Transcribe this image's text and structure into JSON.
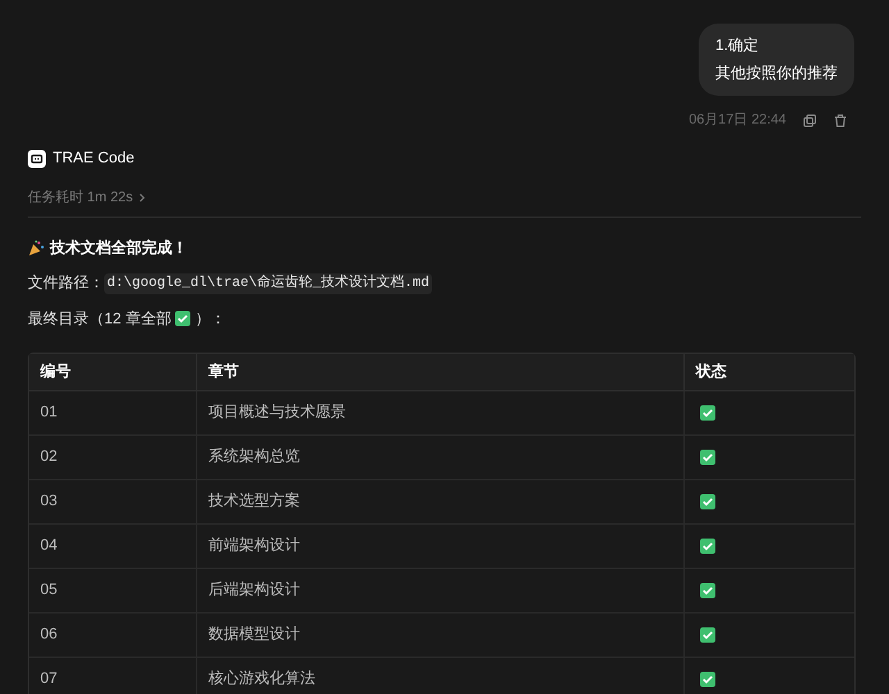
{
  "user_message": {
    "lines": [
      "1.确定",
      "其他按照你的推荐"
    ],
    "timestamp": "06月17日 22:44"
  },
  "assistant": {
    "name": "TRAE Code",
    "duration": "任务耗时 1m 22s",
    "title": "技术文档全部完成！",
    "path_label": "文件路径：",
    "path": "d:\\google_dl\\trae\\命运齿轮_技术设计文档.md",
    "toc_before": "最终目录（12 章全部",
    "toc_done": true,
    "toc_after": "）："
  },
  "table": {
    "columns": [
      "编号",
      "章节",
      "状态"
    ],
    "rows": [
      {
        "number": "01",
        "chapter": "项目概述与技术愿景",
        "done": true
      },
      {
        "number": "02",
        "chapter": "系统架构总览",
        "done": true
      },
      {
        "number": "03",
        "chapter": "技术选型方案",
        "done": true
      },
      {
        "number": "04",
        "chapter": "前端架构设计",
        "done": true
      },
      {
        "number": "05",
        "chapter": "后端架构设计",
        "done": true
      },
      {
        "number": "06",
        "chapter": "数据模型设计",
        "done": true
      },
      {
        "number": "07",
        "chapter": "核心游戏化算法",
        "done": true
      }
    ]
  }
}
